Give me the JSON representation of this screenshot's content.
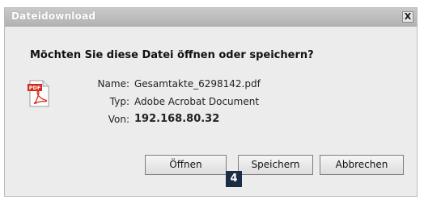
{
  "dialog": {
    "title": "Dateidownload",
    "close_label": "X",
    "question": "Möchten Sie diese Datei öffnen oder speichern?"
  },
  "file": {
    "icon": "pdf-file-icon",
    "icon_text": "PDF",
    "name_label": "Name:",
    "name_value": "Gesamtakte_6298142.pdf",
    "type_label": "Typ:",
    "type_value": "Adobe Acrobat Document",
    "from_label": "Von:",
    "from_value": "192.168.80.32"
  },
  "buttons": {
    "open": "Öffnen",
    "save": "Speichern",
    "cancel": "Abbrechen"
  },
  "badge": "4",
  "colors": {
    "pdf_red": "#d52a1e",
    "badge_bg": "#1b2c45"
  }
}
